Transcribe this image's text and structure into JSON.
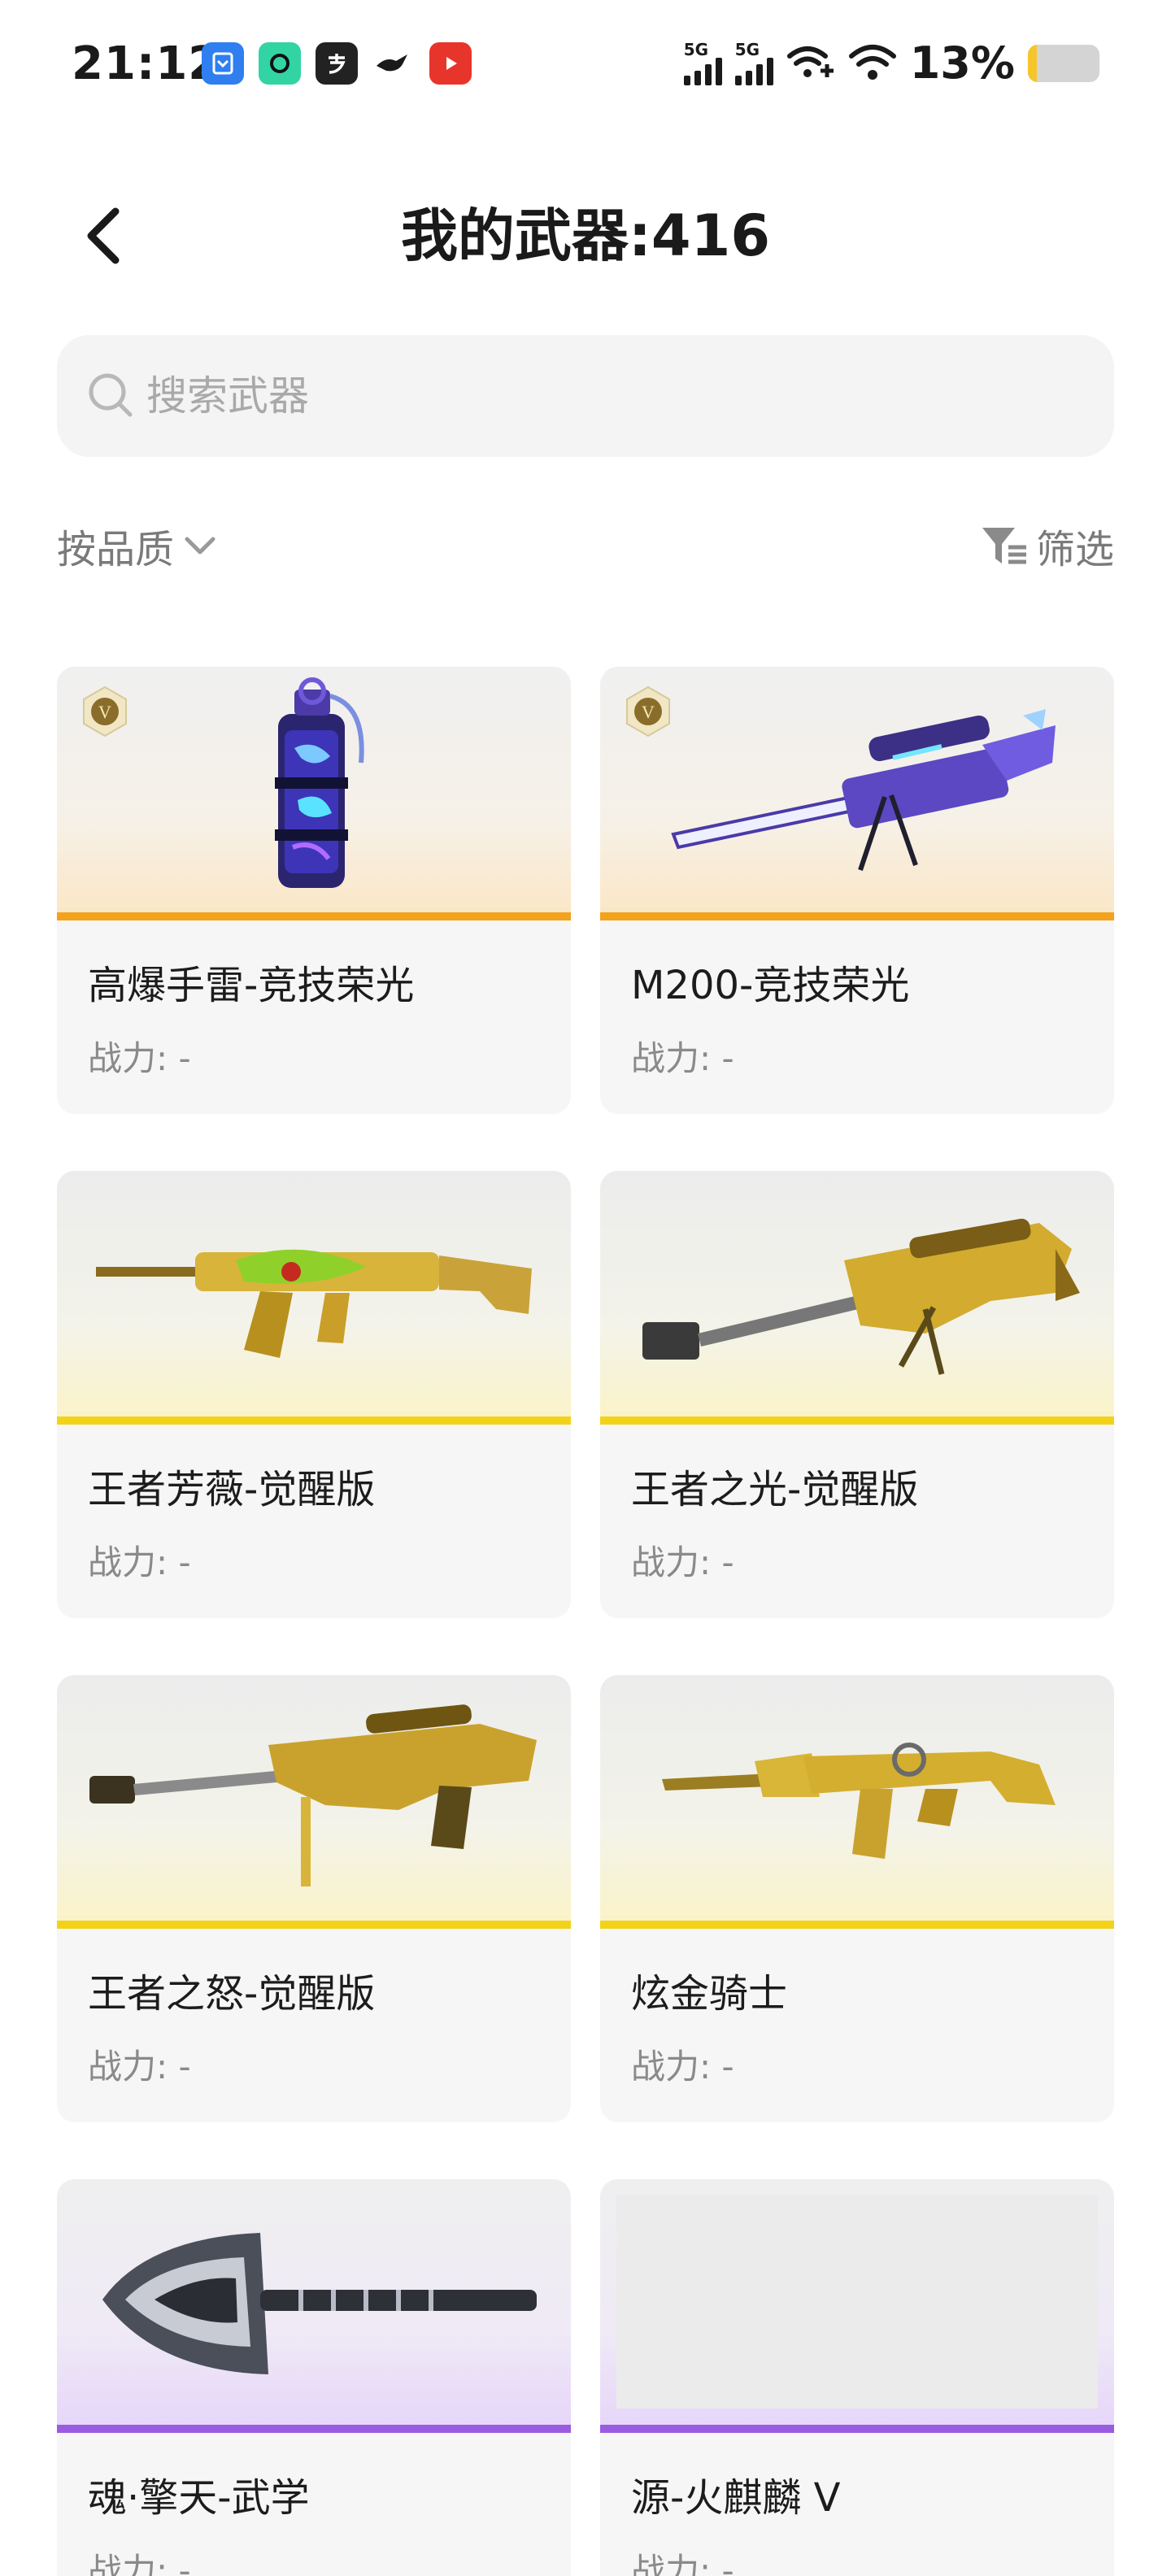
{
  "status_bar": {
    "time": "21:12",
    "signal_labels": [
      "5G",
      "5G"
    ],
    "battery_percent": "13%",
    "battery_level": 0.13,
    "app_icons": [
      "notes-app-icon",
      "camera-app-icon",
      "alipay-app-icon",
      "bird-app-icon",
      "video-app-icon"
    ]
  },
  "header": {
    "title": "我的武器:416"
  },
  "search": {
    "placeholder": "搜索武器",
    "value": ""
  },
  "filters": {
    "sort_label": "按品质",
    "filter_label": "筛选"
  },
  "colors": {
    "orange_strip": "#f4a21c",
    "yellow_strip": "#f2d31a",
    "purple_strip": "#9b5be0"
  },
  "weapons": [
    {
      "name": "高爆手雷-竞技荣光",
      "power": "战力: -",
      "badge": "V",
      "icon": "grenade-icon"
    },
    {
      "name": "M200-竞技荣光",
      "power": "战力: -",
      "badge": "V",
      "icon": "sniper-rifle-icon"
    },
    {
      "name": "王者芳薇-觉醒版",
      "power": "战力: -",
      "icon": "assault-rifle-icon"
    },
    {
      "name": "王者之光-觉醒版",
      "power": "战力: -",
      "icon": "heavy-sniper-icon"
    },
    {
      "name": "王者之怒-觉醒版",
      "power": "战力: -",
      "icon": "gold-sniper-icon"
    },
    {
      "name": "炫金骑士",
      "power": "战力: -",
      "icon": "gold-rifle-icon"
    },
    {
      "name": "魂·擎天-武学",
      "power": "战力: -",
      "icon": "shovel-icon"
    },
    {
      "name": "源-火麒麟 V",
      "power": "战力: -",
      "icon": "placeholder-image"
    }
  ]
}
